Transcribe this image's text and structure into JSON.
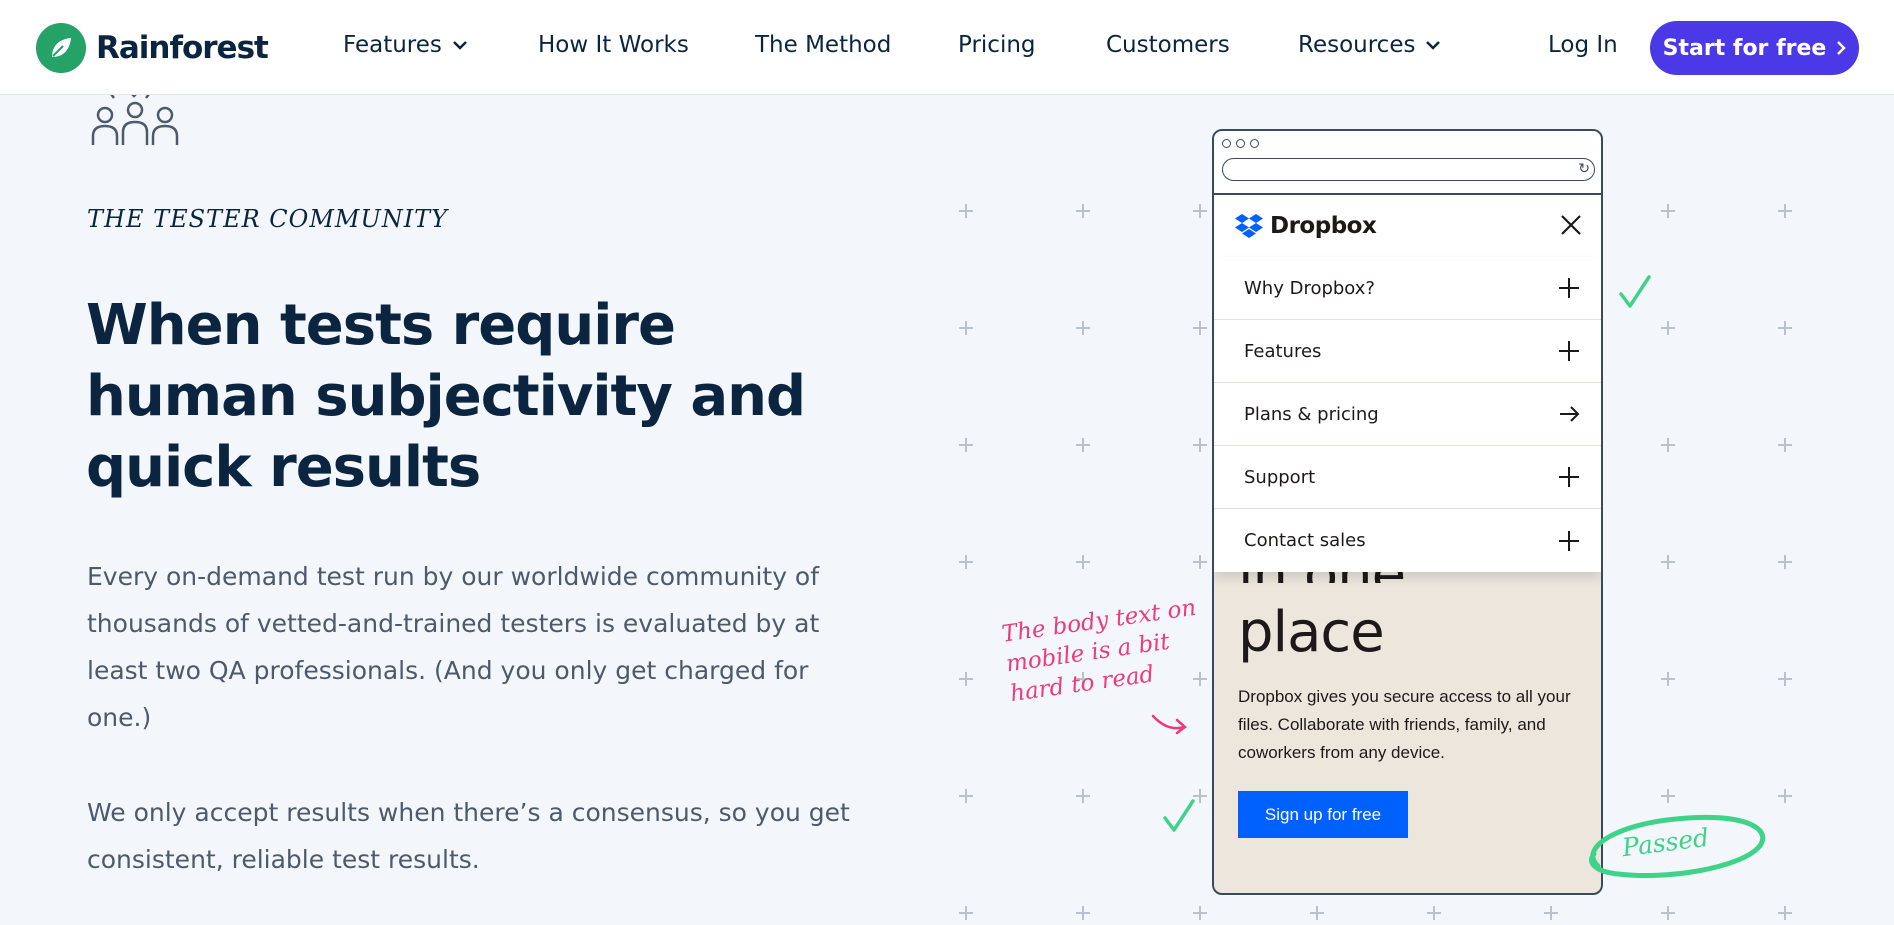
{
  "header": {
    "brand": "Rainforest",
    "nav": [
      {
        "label": "Features",
        "dropdown": true
      },
      {
        "label": "How It Works",
        "dropdown": false
      },
      {
        "label": "The Method",
        "dropdown": false
      },
      {
        "label": "Pricing",
        "dropdown": false
      },
      {
        "label": "Customers",
        "dropdown": false
      },
      {
        "label": "Resources",
        "dropdown": true
      }
    ],
    "login_label": "Log In",
    "cta_label": "Start for free"
  },
  "section": {
    "eyebrow": "THE TESTER COMMUNITY",
    "headline": "When tests require human subjectivity and quick results",
    "paragraph1": "Every on-demand test run by our worldwide community of thousands of vetted-and-trained testers is evaluated by at least two QA professionals. (And you only get charged for one.)",
    "paragraph2": "We only accept results when there’s a consensus, so you get consistent, reliable test results."
  },
  "mockup": {
    "brand": "Dropbox",
    "menu": [
      {
        "label": "Why Dropbox?",
        "icon": "plus-icon"
      },
      {
        "label": "Features",
        "icon": "plus-icon"
      },
      {
        "label": "Plans & pricing",
        "icon": "arrow-right-icon"
      },
      {
        "label": "Support",
        "icon": "plus-icon"
      },
      {
        "label": "Contact sales",
        "icon": "plus-icon"
      }
    ],
    "hero_line1": "in one",
    "hero_line2": "place",
    "body": "Dropbox gives you secure access to all your files. Collaborate with friends, family, and coworkers from any device.",
    "signup_label": "Sign up for free"
  },
  "annotations": {
    "note": "The body text on mobile is a bit hard to read",
    "passed": "Passed"
  },
  "colors": {
    "brand_green": "#24a267",
    "cta_purple": "#4b38e6",
    "dropbox_blue": "#0061fe",
    "note_pink": "#ec3a7e",
    "check_green": "#3fd38a"
  }
}
